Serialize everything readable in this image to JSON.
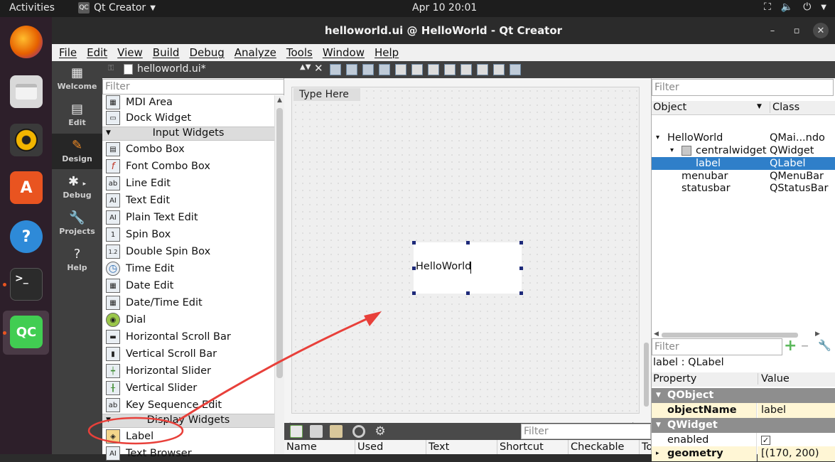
{
  "topbar": {
    "activities": "Activities",
    "app_name": "Qt Creator",
    "app_badge": "QC",
    "clock": "Apr 10  20:01"
  },
  "dock": {
    "apps": [
      {
        "name": "firefox-icon",
        "color": "#e66000"
      },
      {
        "name": "files-icon",
        "color": "#cfcfcf"
      },
      {
        "name": "rhythmbox-icon",
        "color": "#f2b500"
      },
      {
        "name": "software-icon",
        "color": "#e95420"
      },
      {
        "name": "help-icon",
        "color": "#2e8ad8"
      },
      {
        "name": "terminal-icon",
        "color": "#2b2b2b"
      },
      {
        "name": "qtcreator-icon",
        "color": "#41cd52",
        "label": "QC"
      }
    ]
  },
  "window": {
    "title": "helloworld.ui @ HelloWorld - Qt Creator"
  },
  "menubar": [
    "File",
    "Edit",
    "View",
    "Build",
    "Debug",
    "Analyze",
    "Tools",
    "Window",
    "Help"
  ],
  "modes": [
    {
      "label": "Welcome",
      "icon": "grid-icon"
    },
    {
      "label": "Edit",
      "icon": "document-icon"
    },
    {
      "label": "Design",
      "icon": "pencil-icon",
      "active": true
    },
    {
      "label": "Debug",
      "icon": "bug-icon"
    },
    {
      "label": "Projects",
      "icon": "wrench-icon"
    },
    {
      "label": "Help",
      "icon": "question-icon"
    }
  ],
  "editor": {
    "file_name": "helloworld.ui*"
  },
  "widgetbox": {
    "filter_placeholder": "Filter",
    "items_top": [
      {
        "label": "MDI Area",
        "glyph": "▦"
      },
      {
        "label": "Dock Widget",
        "glyph": "▭"
      }
    ],
    "category_input": "Input Widgets",
    "items_input": [
      {
        "label": "Combo Box",
        "glyph": "▤"
      },
      {
        "label": "Font Combo Box",
        "glyph": "f"
      },
      {
        "label": "Line Edit",
        "glyph": "ab"
      },
      {
        "label": "Text Edit",
        "glyph": "AI"
      },
      {
        "label": "Plain Text Edit",
        "glyph": "AI"
      },
      {
        "label": "Spin Box",
        "glyph": "1"
      },
      {
        "label": "Double Spin Box",
        "glyph": "1.2"
      },
      {
        "label": "Time Edit",
        "glyph": "◷"
      },
      {
        "label": "Date Edit",
        "glyph": "▦"
      },
      {
        "label": "Date/Time Edit",
        "glyph": "▦"
      },
      {
        "label": "Dial",
        "glyph": "◉"
      },
      {
        "label": "Horizontal Scroll Bar",
        "glyph": "▬"
      },
      {
        "label": "Vertical Scroll Bar",
        "glyph": "▮"
      },
      {
        "label": "Horizontal Slider",
        "glyph": "┿"
      },
      {
        "label": "Vertical Slider",
        "glyph": "╂"
      },
      {
        "label": "Key Sequence Edit",
        "glyph": "ab"
      }
    ],
    "category_display": "Display Widgets",
    "items_display": [
      {
        "label": "Label",
        "glyph": "◈"
      },
      {
        "label": "Text Browser",
        "glyph": "AI"
      }
    ]
  },
  "form": {
    "type_here": "Type Here",
    "label_text": "HelloWorld"
  },
  "action_editor": {
    "filter_placeholder": "Filter",
    "columns": [
      "Name",
      "Used",
      "Text",
      "Shortcut",
      "Checkable",
      "To"
    ]
  },
  "object_inspector": {
    "filter_placeholder": "Filter",
    "col_object": "Object",
    "col_class": "Class",
    "rows": [
      {
        "object": "HelloWorld",
        "class": "QMai...ndo",
        "depth": 0,
        "expander": "▾"
      },
      {
        "object": "centralwidget",
        "class": "QWidget",
        "depth": 1,
        "expander": "▾"
      },
      {
        "object": "label",
        "class": "QLabel",
        "depth": 2,
        "selected": true
      },
      {
        "object": "menubar",
        "class": "QMenuBar",
        "depth": 1
      },
      {
        "object": "statusbar",
        "class": "QStatusBar",
        "depth": 1
      }
    ]
  },
  "property_editor": {
    "filter_placeholder": "Filter",
    "context": "label : QLabel",
    "col_property": "Property",
    "col_value": "Value",
    "group_qobject": "QObject",
    "object_name_key": "objectName",
    "object_name_value": "label",
    "group_qwidget": "QWidget",
    "enabled_key": "enabled",
    "enabled_value": "✓",
    "geometry_key": "geometry",
    "geometry_value": "[(170, 200)"
  },
  "annotation": {
    "color": "#e8403a"
  }
}
